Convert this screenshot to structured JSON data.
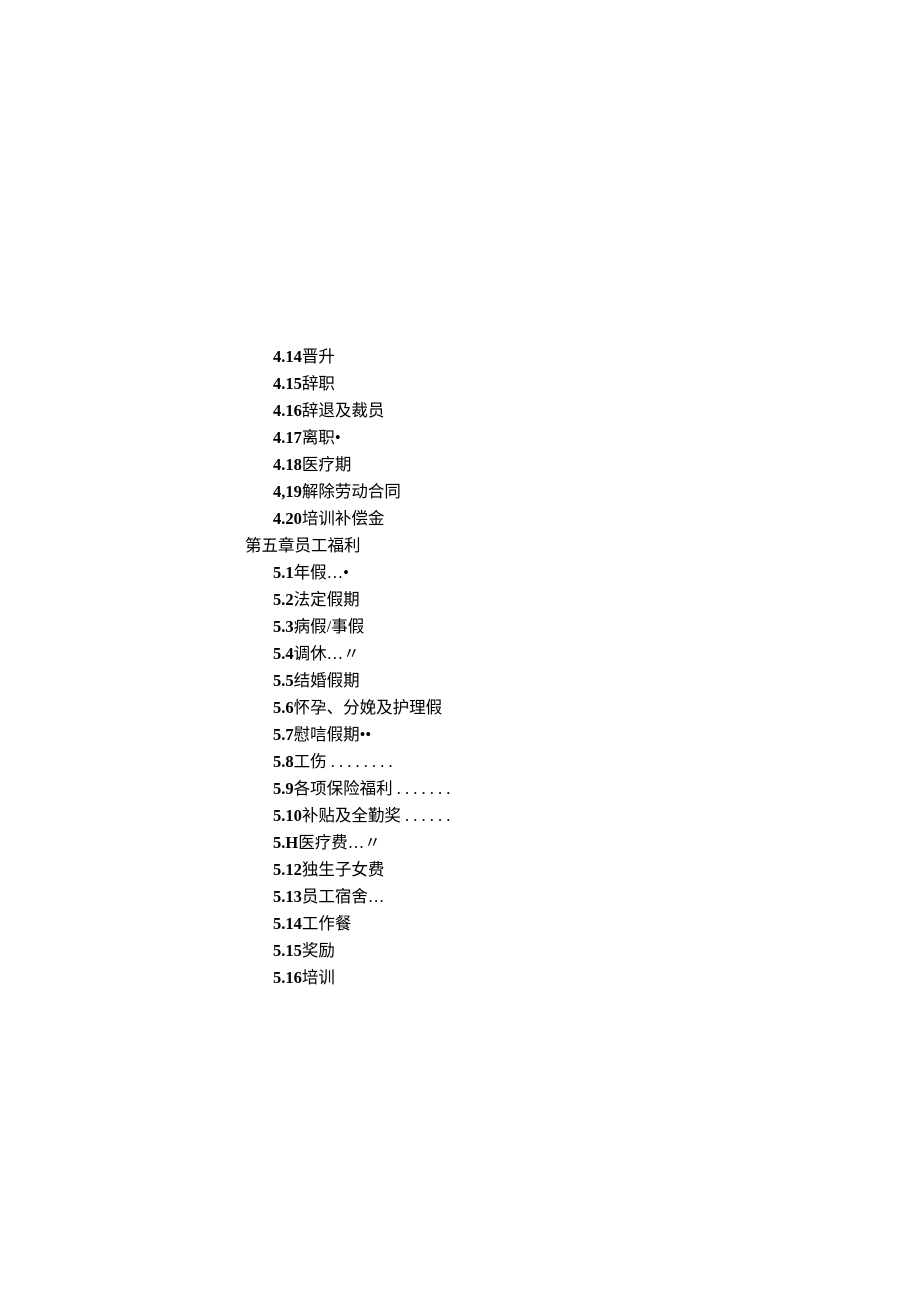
{
  "entries": [
    {
      "type": "item",
      "num": "4.14",
      "text": "晋升",
      "trail": ""
    },
    {
      "type": "item",
      "num": "4.15",
      "text": "辞职",
      "trail": ""
    },
    {
      "type": "item",
      "num": "4.16",
      "text": "辞退及裁员",
      "trail": ""
    },
    {
      "type": "item",
      "num": "4.17",
      "text": "离职",
      "trail": "•"
    },
    {
      "type": "item",
      "num": "4.18",
      "text": "医疗期",
      "trail": ""
    },
    {
      "type": "item",
      "num": "4,19",
      "text": "解除劳动合同",
      "trail": ""
    },
    {
      "type": "item",
      "num": "4.20",
      "text": "培训补偿金",
      "trail": ""
    },
    {
      "type": "heading",
      "num": "",
      "text": "第五章员工福利",
      "trail": ""
    },
    {
      "type": "item",
      "num": "5.1",
      "text": "年假",
      "trail": "…•"
    },
    {
      "type": "item",
      "num": "5.2",
      "text": "法定假期",
      "trail": ""
    },
    {
      "type": "item",
      "num": "5.3",
      "text": "病假/事假",
      "trail": ""
    },
    {
      "type": "item",
      "num": "5.4",
      "text": "调休",
      "trail": "…〃"
    },
    {
      "type": "item",
      "num": "5.5",
      "text": "结婚假期",
      "trail": ""
    },
    {
      "type": "item",
      "num": "5.6",
      "text": "怀孕、分娩及护理假",
      "trail": ""
    },
    {
      "type": "item",
      "num": "5.7",
      "text": "慰唁假期",
      "trail": "••"
    },
    {
      "type": "item",
      "num": "5.8",
      "text": "工伤",
      "trail": " . . . . . . . ."
    },
    {
      "type": "item",
      "num": "5.9",
      "text": "各项保险福利",
      "trail": " . . . . . . ."
    },
    {
      "type": "item",
      "num": "5.10",
      "text": "补贴及全勤奖",
      "trail": " . . . . . ."
    },
    {
      "type": "item",
      "num": "5.H",
      "text": "医疗费",
      "trail": "…〃"
    },
    {
      "type": "item",
      "num": "5.12",
      "text": "独生子女费",
      "trail": ""
    },
    {
      "type": "item",
      "num": "5.13",
      "text": "员工宿舍",
      "trail": "…"
    },
    {
      "type": "item",
      "num": "5.14",
      "text": "工作餐",
      "trail": ""
    },
    {
      "type": "item",
      "num": "5.15",
      "text": "奖励",
      "trail": ""
    },
    {
      "type": "item",
      "num": "5.16",
      "text": "培训",
      "trail": ""
    }
  ]
}
